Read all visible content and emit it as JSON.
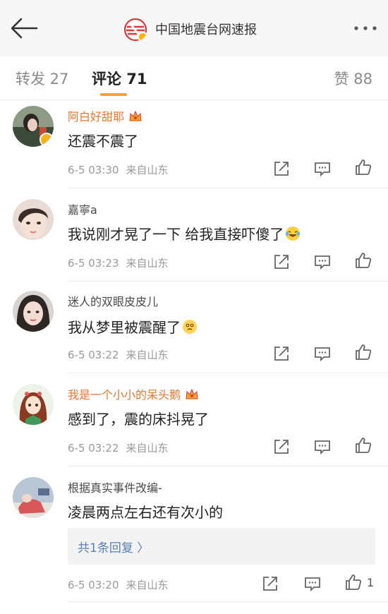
{
  "header": {
    "title": "中国地震台网速报",
    "back_icon": "back-arrow-icon",
    "more_icon": "more-dots-icon"
  },
  "tabs": {
    "repost": "转发 27",
    "comment": "评论 71",
    "like": "赞 88",
    "accent_color": "#f2a03a"
  },
  "comments": [
    {
      "user": "阿白好甜耶",
      "vip": true,
      "verified": true,
      "text": "还震不震了",
      "emoji": "",
      "time": "6-5 03:30",
      "source": "来自山东",
      "likes": ""
    },
    {
      "user": "嘉寧a",
      "vip": false,
      "verified": false,
      "text": "我说刚才晃了一下 给我直接吓傻了",
      "emoji": "laughing-tears-emoji",
      "time": "6-5 03:23",
      "source": "来自山东",
      "likes": ""
    },
    {
      "user": "迷人的双眼皮皮儿",
      "vip": false,
      "verified": false,
      "text": "我从梦里被震醒了",
      "emoji": "dizzy-face-emoji",
      "time": "6-5 03:22",
      "source": "来自山东",
      "likes": ""
    },
    {
      "user": "我是一个小小的呆头鹅",
      "vip": true,
      "verified": false,
      "text": "感到了，震的床抖晃了",
      "emoji": "",
      "time": "6-5 03:22",
      "source": "来自山东",
      "likes": ""
    },
    {
      "user": "根据真实事件改编-",
      "vip": false,
      "verified": false,
      "text": "凌晨两点左右还有次小的",
      "emoji": "",
      "time": "6-5 03:20",
      "source": "来自山东",
      "likes": "1",
      "reply_summary": "共1条回复 〉"
    }
  ],
  "colors": {
    "vip_name": "#e7782f",
    "normal_name": "#4a4a4a",
    "link": "#5a7fb3",
    "meta": "#9a9a9a"
  }
}
